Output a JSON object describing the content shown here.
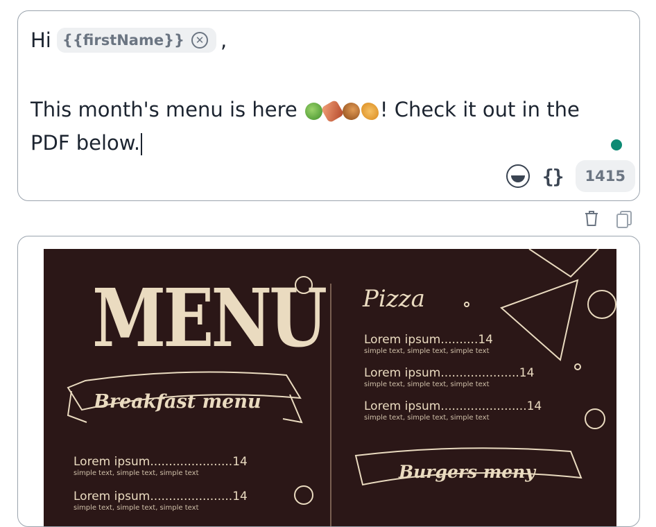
{
  "composer": {
    "greeting": "Hi",
    "variable_chip": "{{firstName}}",
    "comma": ",",
    "line_text_before_emoji": "This month's menu is here",
    "line_text_after_emoji": "! Check it out in the",
    "line2_text": "PDF below.",
    "emoji_icons": [
      "salad-emoji",
      "bacon-emoji",
      "poultry-leg-emoji",
      "croissant-emoji"
    ],
    "char_count": "1415",
    "status_color": "#0d8a74"
  },
  "attachment": {
    "menu_title": "MENU",
    "breakfast_banner": "Breakfast menu",
    "pizza_heading": "Pizza",
    "burgers_banner": "Burgers meny",
    "pizza_items": [
      {
        "name": "Lorem ipsum..........14",
        "desc": "simple text, simple text, simple text"
      },
      {
        "name": "Lorem ipsum.....................14",
        "desc": "simple text, simple text, simple text"
      },
      {
        "name": "Lorem ipsum.......................14",
        "desc": "simple text, simple text, simple text"
      }
    ],
    "breakfast_items": [
      {
        "name": "Lorem ipsum......................14",
        "desc": "simple text, simple text, simple text"
      },
      {
        "name": "Lorem ipsum......................14",
        "desc": "simple text, simple text, simple text"
      }
    ],
    "colors": {
      "background": "#2b1717",
      "ink": "#eadbc0"
    }
  }
}
